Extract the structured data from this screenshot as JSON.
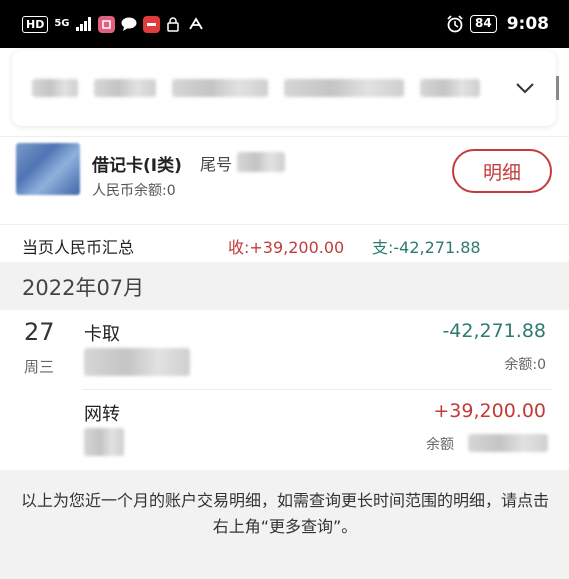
{
  "status_bar": {
    "left_badge": "HD",
    "network": "5G",
    "time": "9:08",
    "battery": "84"
  },
  "card": {
    "title": "借记卡(I类)",
    "tail_label": "尾号",
    "balance": "人民币余额:0",
    "detail_button": "明细"
  },
  "summary": {
    "label": "当页人民币汇总",
    "income": "收:+39,200.00",
    "expense": "支:-42,271.88"
  },
  "month": "2022年07月",
  "day": {
    "date": "27",
    "weekday": "周三"
  },
  "transactions": [
    {
      "type": "卡取",
      "amount": "-42,271.88",
      "balance": "余额:0"
    },
    {
      "type": "网转",
      "amount": "+39,200.00",
      "balance": "余额"
    }
  ],
  "footer": {
    "line": "以上为您近一个月的账户交易明细，如需查询更长时间范围的明细，请点击右上角“更多查询”。"
  },
  "colors": {
    "accent_red": "#c43b3b",
    "income": "#c23b3b",
    "expense": "#2e7a6e"
  }
}
